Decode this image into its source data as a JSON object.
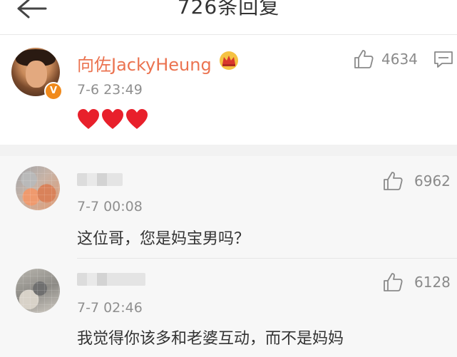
{
  "header": {
    "title": "726条回复",
    "back_icon": "back-arrow-icon"
  },
  "post": {
    "author": "向佐JackyHeung",
    "time": "7-6 23:49",
    "verified_badge": "V",
    "crown_icon": "crown-icon",
    "content_icons": [
      "heart-icon",
      "heart-icon",
      "heart-icon"
    ],
    "likes": "4634",
    "like_icon": "thumbs-up-icon",
    "more_icon": "comment-icon"
  },
  "comments": [
    {
      "time": "7-7 00:08",
      "text": "这位哥，您是妈宝男吗？",
      "likes": "6962"
    },
    {
      "time": "7-7 02:46",
      "text": "我觉得你该多和老婆互动，而不是妈妈",
      "likes": "6128"
    }
  ],
  "colors": {
    "accent_name": "#eb7350",
    "heart": "#e8202b",
    "verify_badge": "#f08a1c",
    "muted_text": "#8f8f8f"
  }
}
